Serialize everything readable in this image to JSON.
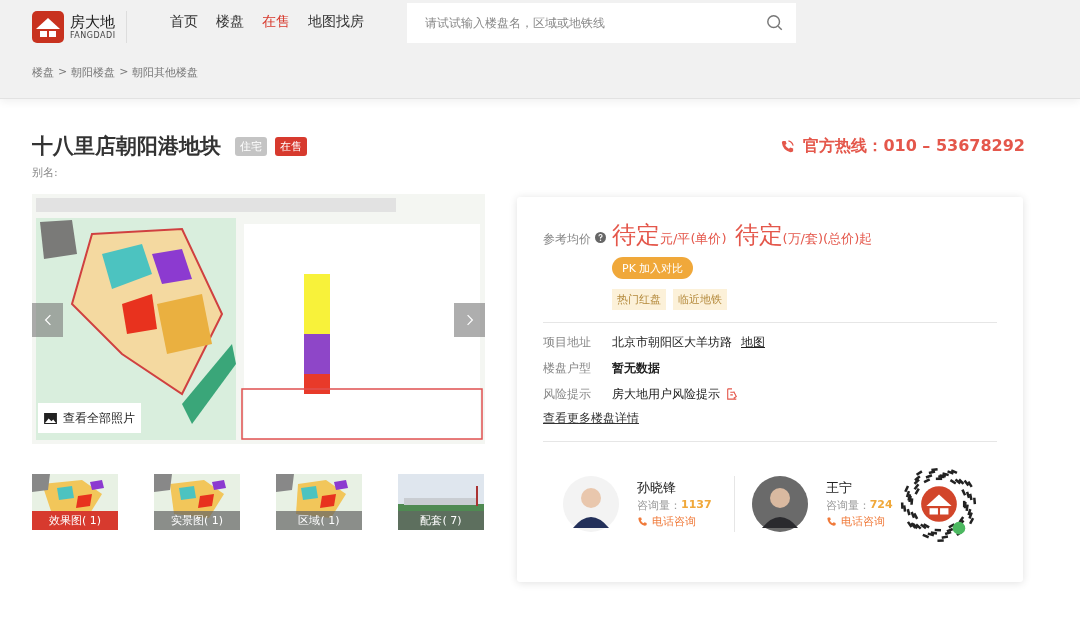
{
  "header": {
    "logo": {
      "name": "房大地",
      "subtitle": "FANGDADI"
    },
    "nav": [
      {
        "label": "首页",
        "selected": false
      },
      {
        "label": "楼盘",
        "selected": false
      },
      {
        "label": "在售",
        "selected": true
      },
      {
        "label": "地图找房",
        "selected": false
      }
    ],
    "search": {
      "placeholder": "请试试输入楼盘名，区域或地铁线"
    }
  },
  "breadcrumb": {
    "items": [
      "楼盘",
      "朝阳楼盘",
      "朝阳其他楼盘"
    ],
    "separator": ">"
  },
  "title": "十八里店朝阳港地块",
  "tags": [
    {
      "label": "住宅",
      "kind": "type"
    },
    {
      "label": "在售",
      "kind": "status"
    }
  ],
  "alias": "别名:",
  "hotline": "官方热线：010 – 53678292",
  "gallery": {
    "view_all": "查看全部照片",
    "thumbnails": [
      {
        "label": "效果图( 1)",
        "selected": true
      },
      {
        "label": "实景图( 1)",
        "selected": false
      },
      {
        "label": "区域( 1)",
        "selected": false
      },
      {
        "label": "配套( 7)",
        "selected": false
      }
    ]
  },
  "info": {
    "price_label": "参考均价",
    "prices": [
      {
        "value": "待定",
        "unit": "元/平(单价)"
      },
      {
        "value": "待定",
        "unit": "(万/套)(总价)起"
      }
    ],
    "compare_button": "PK 加入对比",
    "features": [
      "热门红盘",
      "临近地铁"
    ],
    "details": [
      {
        "label": "项目地址",
        "value": "北京市朝阳区大羊坊路",
        "kind": "link",
        "link": "地图"
      },
      {
        "label": "楼盘户型",
        "value": "暂无数据",
        "kind": "bold"
      },
      {
        "label": "风险提示",
        "value": "房大地用户风险提示",
        "kind": "icon"
      }
    ],
    "more_link": "查看更多楼盘详情",
    "agents": [
      {
        "name": "孙晓锋",
        "count_label": "咨询量：",
        "count": "1137",
        "call": "电话咨询"
      },
      {
        "name": "王宁",
        "count_label": "咨询量：",
        "count": "724",
        "call": "电话咨询"
      }
    ]
  }
}
